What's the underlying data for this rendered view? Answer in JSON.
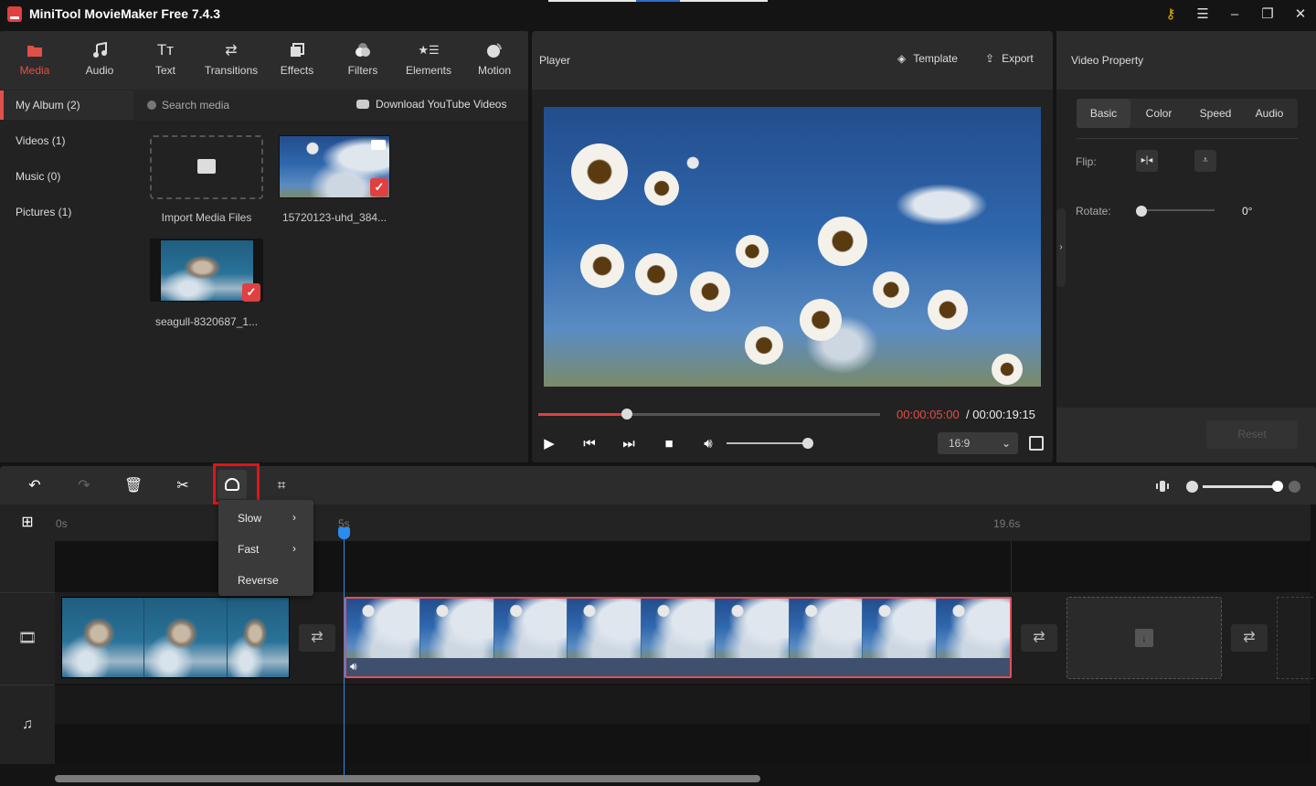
{
  "app": {
    "title": "MiniTool MovieMaker Free 7.4.3"
  },
  "window_controls": {
    "key": "key-icon",
    "menu": "menu-icon",
    "minimize": "minimize-icon",
    "maximize": "maximize-icon",
    "close": "close-icon"
  },
  "toolbar": {
    "tools": [
      {
        "label": "Media",
        "icon": "folder-icon",
        "active": true
      },
      {
        "label": "Audio",
        "icon": "music-note-icon"
      },
      {
        "label": "Text",
        "icon": "text-icon"
      },
      {
        "label": "Transitions",
        "icon": "swap-icon"
      },
      {
        "label": "Effects",
        "icon": "effects-icon"
      },
      {
        "label": "Filters",
        "icon": "filters-icon"
      },
      {
        "label": "Elements",
        "icon": "elements-icon"
      },
      {
        "label": "Motion",
        "icon": "motion-icon"
      }
    ],
    "active_color": "#e0504a"
  },
  "sidebar": {
    "items": [
      {
        "label": "My Album (2)",
        "active": true
      },
      {
        "label": "Videos (1)"
      },
      {
        "label": "Music (0)"
      },
      {
        "label": "Pictures (1)"
      }
    ]
  },
  "media": {
    "search_placeholder": "Search media",
    "download_label": "Download YouTube Videos",
    "import_label": "Import Media Files",
    "items": [
      {
        "name": "15720123-uhd_384...",
        "type": "video",
        "selected": true
      },
      {
        "name": "seagull-8320687_1...",
        "type": "image",
        "selected": true
      }
    ]
  },
  "player": {
    "title": "Player",
    "template_label": "Template",
    "export_label": "Export",
    "current_time": "00:00:05:00",
    "total_time": "/ 00:00:19:15",
    "progress_percent": 26,
    "volume_percent": 100,
    "aspect_ratio": "16:9"
  },
  "property": {
    "title": "Video Property",
    "tabs": [
      "Basic",
      "Color",
      "Speed",
      "Audio"
    ],
    "active_tab": "Basic",
    "flip_label": "Flip:",
    "rotate_label": "Rotate:",
    "rotate_value": "0°",
    "reset_label": "Reset"
  },
  "timeline": {
    "ticks": [
      "0s",
      "5s",
      "19.6s"
    ],
    "zoom_percent": 100,
    "speed_menu": {
      "items": [
        {
          "label": "Slow",
          "submenu": true
        },
        {
          "label": "Fast",
          "submenu": true
        },
        {
          "label": "Reverse",
          "submenu": false
        }
      ]
    },
    "playhead_color": "#2b8cf0",
    "selected_clip_border": "#e0505a"
  }
}
